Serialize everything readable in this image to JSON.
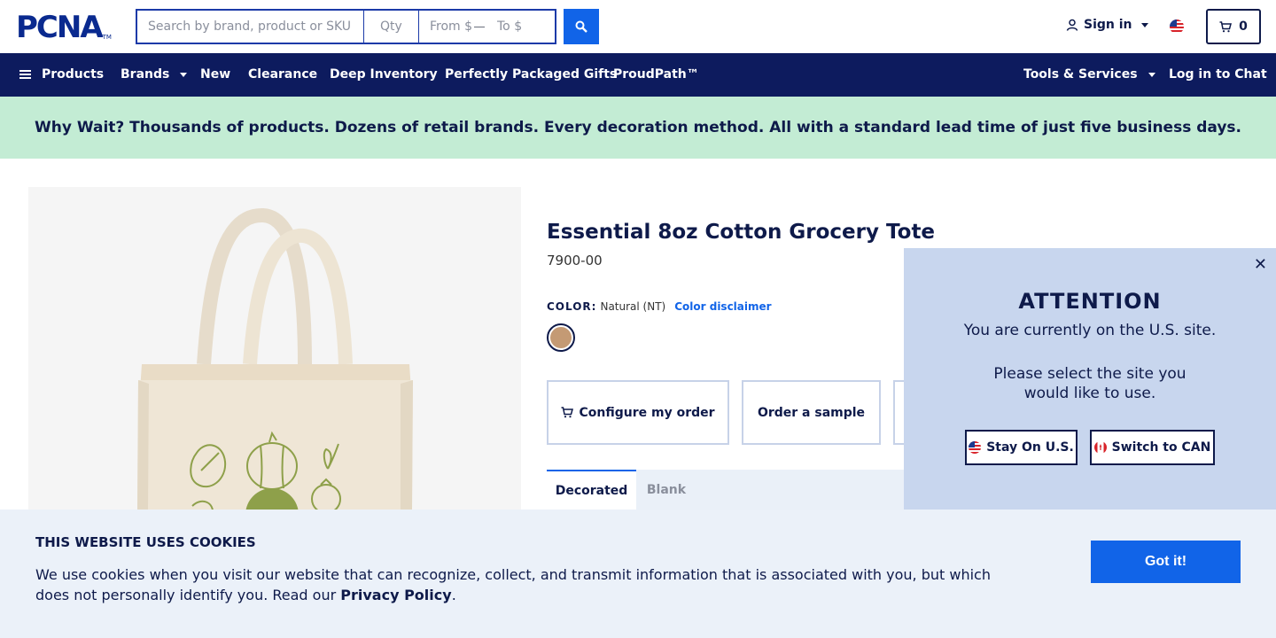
{
  "header": {
    "logo_text": "PCNA",
    "logo_tm": "TM",
    "search_placeholder": "Search by brand, product or SKU",
    "qty_placeholder": "Qty",
    "price_from_placeholder": "From $",
    "price_to_placeholder": "To $",
    "signin_label": "Sign in",
    "cart_count": "0"
  },
  "nav": {
    "products": "Products",
    "brands": "Brands",
    "new": "New",
    "clearance": "Clearance",
    "deep_inventory": "Deep Inventory",
    "gifts": "Perfectly Packaged Gifts",
    "proudpath": "ProudPath™",
    "tools": "Tools & Services",
    "chat": "Log in to Chat"
  },
  "promo": {
    "text": "Why Wait? Thousands of products. Dozens of retail brands. Every decoration method. All with a standard lead time of just five business days."
  },
  "product": {
    "title": "Essential 8oz Cotton Grocery Tote",
    "sku": "7900-00",
    "color_label": "COLOR:",
    "color_value": "Natural (NT)",
    "color_disclaimer": "Color disclaimer",
    "swatch_color": "#c49a74",
    "configure_label": "Configure my order",
    "sample_label": "Order a sample",
    "tabs": [
      "Decorated",
      "Blank"
    ]
  },
  "attention": {
    "title": "ATTENTION",
    "line1": "You are currently on the U.S. site.",
    "line2": "Please select the site you",
    "line3": "would like to use.",
    "stay_label": "Stay On U.S.",
    "switch_label": "Switch to CAN"
  },
  "cookie": {
    "title": "THIS WEBSITE USES COOKIES",
    "text_before": "We use cookies when you visit our website that can recognize, collect, and transmit information that is associated with you, but which does not personally identify you. Read our ",
    "link": "Privacy Policy",
    "text_after": ".",
    "button": "Got it!"
  },
  "colors": {
    "navy": "#0d1b5e",
    "accent_blue": "#1164e8",
    "promo_green": "#c3ecd4",
    "attention_bg": "#c8d6ee",
    "cookie_bg": "#ebf1f9"
  }
}
